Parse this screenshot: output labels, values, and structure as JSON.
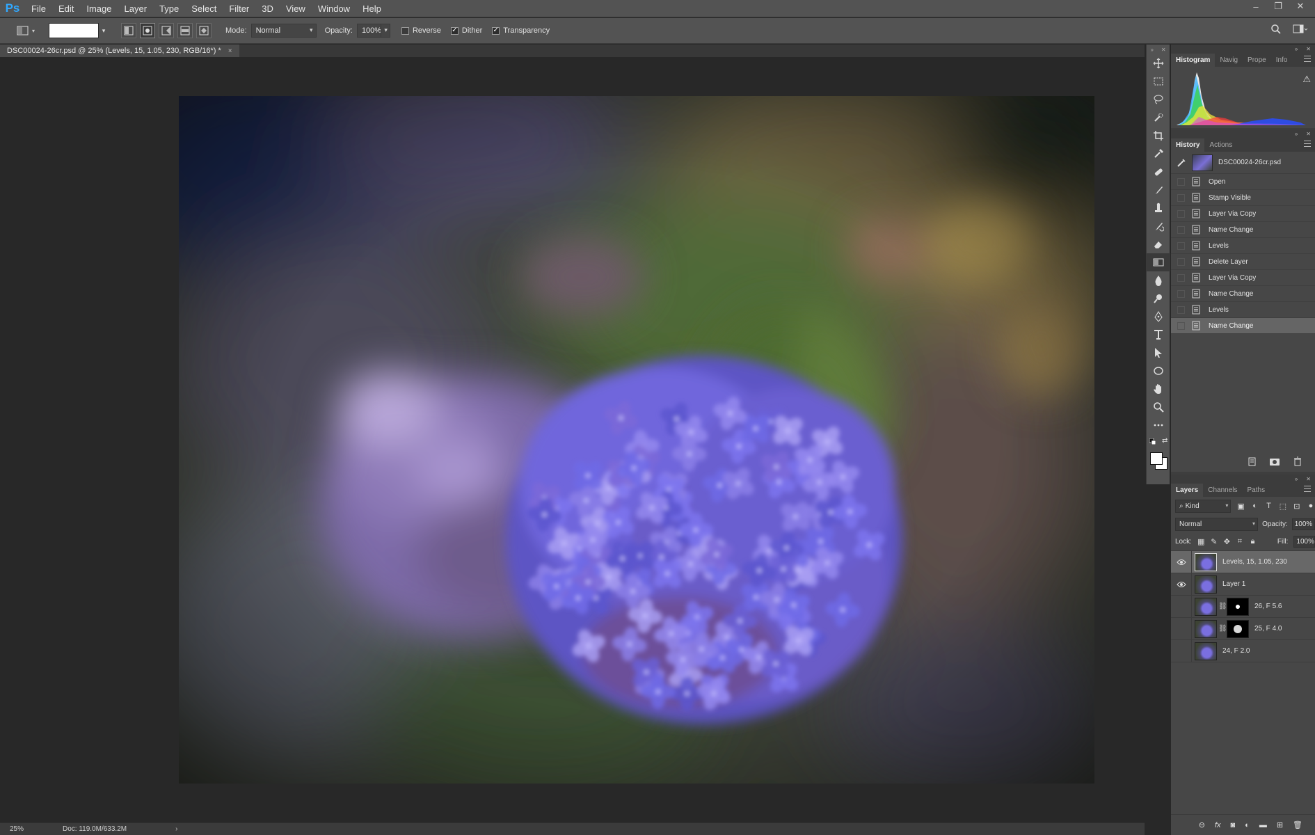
{
  "app": {
    "logo": "Ps"
  },
  "menu": [
    "File",
    "Edit",
    "Image",
    "Layer",
    "Type",
    "Select",
    "Filter",
    "3D",
    "View",
    "Window",
    "Help"
  ],
  "window_controls": {
    "minimize": "–",
    "restore": "❐",
    "close": "✕"
  },
  "options": {
    "mode_label": "Mode:",
    "mode_value": "Normal",
    "opacity_label": "Opacity:",
    "opacity_value": "100%",
    "reverse_label": "Reverse",
    "reverse_checked": false,
    "dither_label": "Dither",
    "dither_checked": true,
    "transparency_label": "Transparency",
    "transparency_checked": true
  },
  "document": {
    "tab_title": "DSC00024-26cr.psd @ 25% (Levels, 15, 1.05, 230, RGB/16*) *",
    "close": "×"
  },
  "status": {
    "zoom": "25%",
    "doc_size": "Doc: 119.0M/633.2M",
    "arrow": "›"
  },
  "top_panel": {
    "tabs": [
      "Histogram",
      "Navig",
      "Prope",
      "Info"
    ],
    "warning": "⚠"
  },
  "history_panel": {
    "tabs": [
      "History",
      "Actions"
    ],
    "snapshot": "DSC00024-26cr.psd",
    "items": [
      "Open",
      "Stamp Visible",
      "Layer Via Copy",
      "Name Change",
      "Levels",
      "Delete Layer",
      "Layer Via Copy",
      "Name Change",
      "Levels",
      "Name Change"
    ],
    "current_index": 9
  },
  "layers_panel": {
    "tabs": [
      "Layers",
      "Channels",
      "Paths"
    ],
    "kind_label": "Kind",
    "blend_mode": "Normal",
    "opacity_label": "Opacity:",
    "opacity_value": "100%",
    "lock_label": "Lock:",
    "fill_label": "Fill:",
    "fill_value": "100%",
    "layers": [
      {
        "name": "Levels, 15, 1.05, 230",
        "visible": true,
        "mask": false,
        "selected": true
      },
      {
        "name": "Layer 1",
        "visible": true,
        "mask": false,
        "selected": false
      },
      {
        "name": "26, F 5.6",
        "visible": false,
        "mask": true,
        "selected": false
      },
      {
        "name": "25, F 4.0",
        "visible": false,
        "mask": true,
        "selected": false
      },
      {
        "name": "24, F 2.0",
        "visible": false,
        "mask": false,
        "selected": false
      }
    ],
    "footer_icons": [
      "link-icon",
      "fx-icon",
      "mask-icon",
      "adjustment-icon",
      "group-icon",
      "new-layer-icon",
      "trash-icon"
    ],
    "fx_label": "fx"
  },
  "tools": [
    "move",
    "marquee",
    "lasso",
    "quick-select",
    "crop",
    "eyedropper",
    "healing",
    "brush",
    "stamp",
    "history-brush",
    "eraser",
    "gradient",
    "blur",
    "dodge",
    "pen",
    "type",
    "path-select",
    "ellipse",
    "hand",
    "zoom",
    "more"
  ],
  "selected_tool": "gradient",
  "colors": {
    "accent": "#31a8ff",
    "chrome": "#535353",
    "panel": "#474747",
    "canvas_bg": "#282828"
  }
}
